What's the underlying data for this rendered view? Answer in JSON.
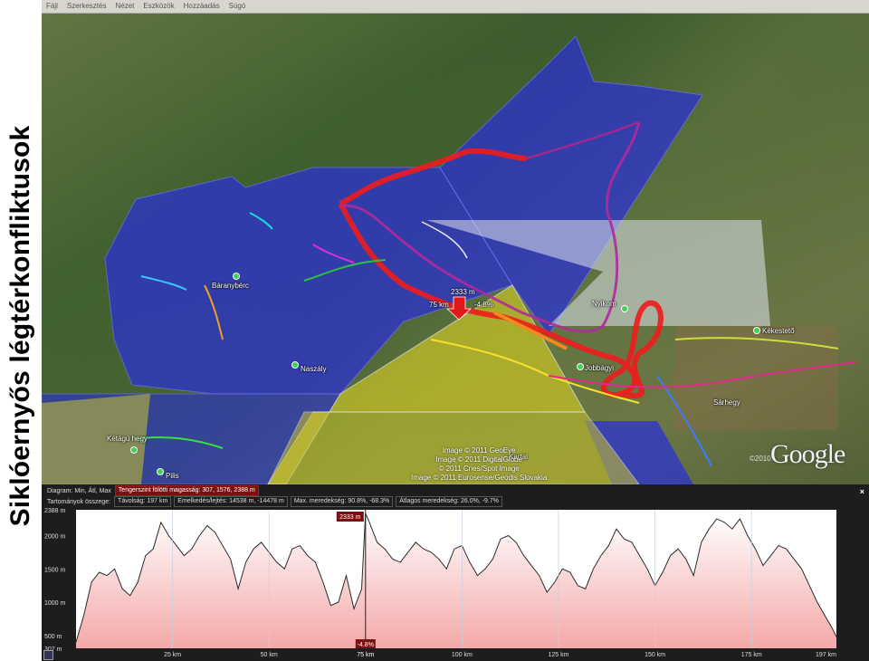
{
  "side_title": "Siklóernyős légtérkonfliktusok",
  "menu": [
    "Fájl",
    "Szerkesztés",
    "Nézet",
    "Eszközök",
    "Hozzáadás",
    "Súgó"
  ],
  "map_labels": {
    "baranyberc": "Báranybérc",
    "naszaly": "Naszály",
    "ketagu": "Kétágú hegy",
    "pilis": "Pilis",
    "nyikom": "Nyikom",
    "jobbagyi": "Jobbágyi",
    "kekesteto": "Kékestető",
    "sarhegy": "Sárhegy",
    "kartal": "Kartal",
    "cursor_alt": "2333 m",
    "cursor_dist": "75 km",
    "cursor_slope": "-4.8%"
  },
  "copyright_lines": [
    "Image © 2011 GeoEye",
    "Image © 2011 DigitalGlobe",
    "© 2011 Cnes/Spot Image",
    "Image © 2011 Eurosense/Geodis Slovakia"
  ],
  "google_logo": "Google",
  "year": "©2010",
  "profile": {
    "row1_label": "Diagram: Min, Átl, Max",
    "row1_value": "Tengerszint fölötti magasság: 307, 1576, 2388 m",
    "row2_label": "Tartományok összege:",
    "distance": "Távolság: 197 km",
    "elev_gain": "Emelkedés/lejtés: 14538 m, -14478 m",
    "max_slope": "Max. meredekség: 90.8%, -68.3%",
    "avg_slope": "Átlagos meredekség: 26.0%, -9.7%",
    "close": "×"
  },
  "chart_data": {
    "type": "area",
    "xlabel": "",
    "ylabel": "",
    "x_ticks": [
      "25 km",
      "50 km",
      "75 km",
      "100 km",
      "125 km",
      "150 km",
      "175 km",
      "197 km"
    ],
    "x_tick_values": [
      25,
      50,
      75,
      100,
      125,
      150,
      175,
      197
    ],
    "y_ticks": [
      "2388 m",
      "2000 m",
      "1500 m",
      "1000 m",
      "500 m",
      "307 m"
    ],
    "y_tick_values": [
      2388,
      2000,
      1500,
      1000,
      500,
      307
    ],
    "xlim": [
      0,
      197
    ],
    "ylim": [
      307,
      2388
    ],
    "cursor": {
      "x": 75,
      "y": 2333,
      "label_top": "2333 m",
      "label_bottom": "-4.8%",
      "label_x": "75 km"
    },
    "series": [
      {
        "x": [
          0,
          2,
          4,
          6,
          8,
          10,
          12,
          14,
          16,
          18,
          20,
          22,
          24,
          26,
          28,
          30,
          32,
          34,
          36,
          38,
          40,
          42,
          44,
          46,
          48,
          50,
          52,
          54,
          56,
          58,
          60,
          62,
          64,
          66,
          68,
          70,
          72,
          74,
          75,
          76,
          78,
          80,
          82,
          84,
          86,
          88,
          90,
          92,
          94,
          96,
          98,
          100,
          102,
          104,
          106,
          108,
          110,
          112,
          114,
          116,
          118,
          120,
          122,
          124,
          126,
          128,
          130,
          132,
          134,
          136,
          138,
          140,
          142,
          144,
          146,
          148,
          150,
          152,
          154,
          156,
          158,
          160,
          162,
          164,
          166,
          168,
          170,
          172,
          174,
          176,
          178,
          180,
          182,
          184,
          186,
          188,
          190,
          192,
          194,
          196,
          197
        ],
        "y": [
          400,
          800,
          1300,
          1450,
          1400,
          1500,
          1200,
          1100,
          1300,
          1700,
          1800,
          2200,
          2000,
          1850,
          1700,
          1800,
          2000,
          2150,
          2050,
          1850,
          1650,
          1200,
          1600,
          1800,
          1900,
          1750,
          1600,
          1500,
          1800,
          1850,
          1700,
          1600,
          1300,
          950,
          1000,
          1400,
          900,
          1200,
          2333,
          2200,
          1900,
          1800,
          1650,
          1600,
          1750,
          1900,
          1800,
          1750,
          1650,
          1500,
          1800,
          1850,
          1600,
          1400,
          1500,
          1650,
          1950,
          2000,
          1900,
          1700,
          1550,
          1400,
          1150,
          1300,
          1500,
          1450,
          1250,
          1200,
          1500,
          1700,
          1850,
          2100,
          1950,
          1900,
          1700,
          1500,
          1250,
          1450,
          1700,
          1800,
          1650,
          1400,
          1900,
          2100,
          2250,
          2200,
          2100,
          2250,
          2000,
          1800,
          1550,
          1700,
          1850,
          1800,
          1650,
          1500,
          1250,
          1000,
          800,
          600,
          480
        ]
      }
    ]
  }
}
